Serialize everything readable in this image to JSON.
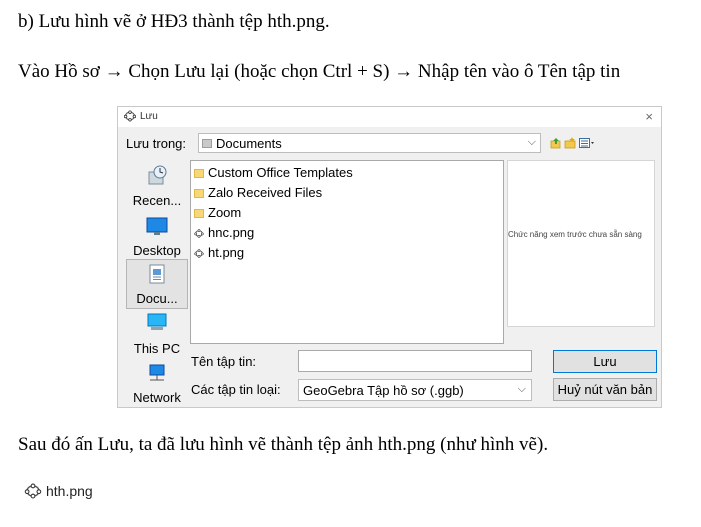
{
  "doc": {
    "p1": "b) Lưu hình vẽ ở HĐ3 thành tệp hth.png.",
    "p2": "Vào Hồ sơ → Chọn Lưu lại (hoặc chọn Ctrl + S) → Nhập tên vào ô Tên tập tin",
    "p3": "Sau đó ấn Lưu, ta đã lưu hình vẽ thành tệp ảnh hth.png (như hình vẽ).",
    "bottom_file": "hth.png"
  },
  "dialog": {
    "title": "Lưu",
    "close": "×",
    "look_in_label": "Lưu trong:",
    "look_in_value": "Documents",
    "places": [
      {
        "label": "Recen...",
        "icon": "recent-icon"
      },
      {
        "label": "Desktop",
        "icon": "desktop-icon"
      },
      {
        "label": "Docu...",
        "icon": "documents-icon"
      },
      {
        "label": "This PC",
        "icon": "computer-icon"
      },
      {
        "label": "Network",
        "icon": "network-icon"
      }
    ],
    "files": [
      {
        "name": "Custom Office Templates",
        "type": "folder"
      },
      {
        "name": "Zalo Received Files",
        "type": "folder"
      },
      {
        "name": "Zoom",
        "type": "folder"
      },
      {
        "name": "hnc.png",
        "type": "geogebra"
      },
      {
        "name": "ht.png",
        "type": "geogebra"
      }
    ],
    "preview_text": "Chức năng xem trước chưa sẵn sàng",
    "filename_label": "Tên tập tin:",
    "filename_value": "",
    "filetype_label": "Các tập tin loại:",
    "filetype_value": "GeoGebra Tập hồ sơ (.ggb)",
    "save_button": "Lưu",
    "cancel_button": "Huỷ nút văn bản"
  }
}
